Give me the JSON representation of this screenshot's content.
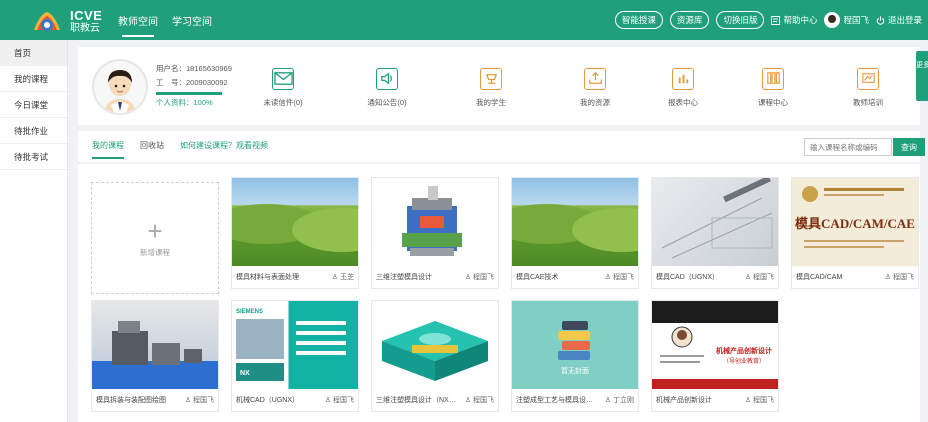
{
  "header": {
    "logo_title": "ICVE",
    "logo_subtitle": "职教云",
    "tabs": [
      "教师空间",
      "学习空间"
    ],
    "pills": [
      "智能授课",
      "资源库",
      "切换旧版"
    ],
    "help": "帮助中心",
    "user": "程国飞",
    "logout": "退出登录",
    "accent": "#1fa07a"
  },
  "sidebar": {
    "items": [
      "首页",
      "我的课程",
      "今日课堂",
      "待批作业",
      "待批考试"
    ]
  },
  "profile": {
    "username": "用户名：18165630969",
    "work_id": "工　号：2009030092",
    "completion_label": "个人资料：",
    "completion": "100%",
    "completion_fraction": 1.0
  },
  "quick": [
    "未读信件(0)",
    "通知公告(0)",
    "我的学生",
    "我的资源",
    "报表中心",
    "课程中心",
    "教师培训"
  ],
  "side_tab": "更多",
  "subnav": {
    "tabs": [
      "我的课程",
      "回收站"
    ],
    "help_link": "如何建设课程？观看视频",
    "search_placeholder": "输入课程名称或编码",
    "search_button": "查询"
  },
  "courses": {
    "add_label": "新增课程",
    "items": [
      {
        "title": "模具材料与表面处理",
        "owner": "王芝"
      },
      {
        "title": "三维注塑模具设计",
        "owner": "程国飞"
      },
      {
        "title": "模具CAE技术",
        "owner": "程国飞"
      },
      {
        "title": "模具CAD（UGNX）",
        "owner": "程国飞"
      },
      {
        "title": "模具CAD/CAM",
        "owner": "程国飞"
      },
      {
        "title": "模具拆装与装配图绘图",
        "owner": "程国飞"
      },
      {
        "title": "机械CAD（UGNX）",
        "owner": "程国飞"
      },
      {
        "title": "三维注塑模具设计（NX12...",
        "owner": "程国飞"
      },
      {
        "title": "注塑成型工艺与模具设计(...",
        "owner": "丁立刚"
      },
      {
        "title": "机械产品创新设计",
        "owner": "程国飞"
      }
    ],
    "thumb_texts": {
      "book_title": "模具CAD/CAM/CAE",
      "teal_caption": "暂无封面",
      "red_title": "机械产品创新设计",
      "red_sub": "（导创业教育）",
      "nx_brand": "SIEMENS",
      "nx_label": "NX"
    }
  }
}
